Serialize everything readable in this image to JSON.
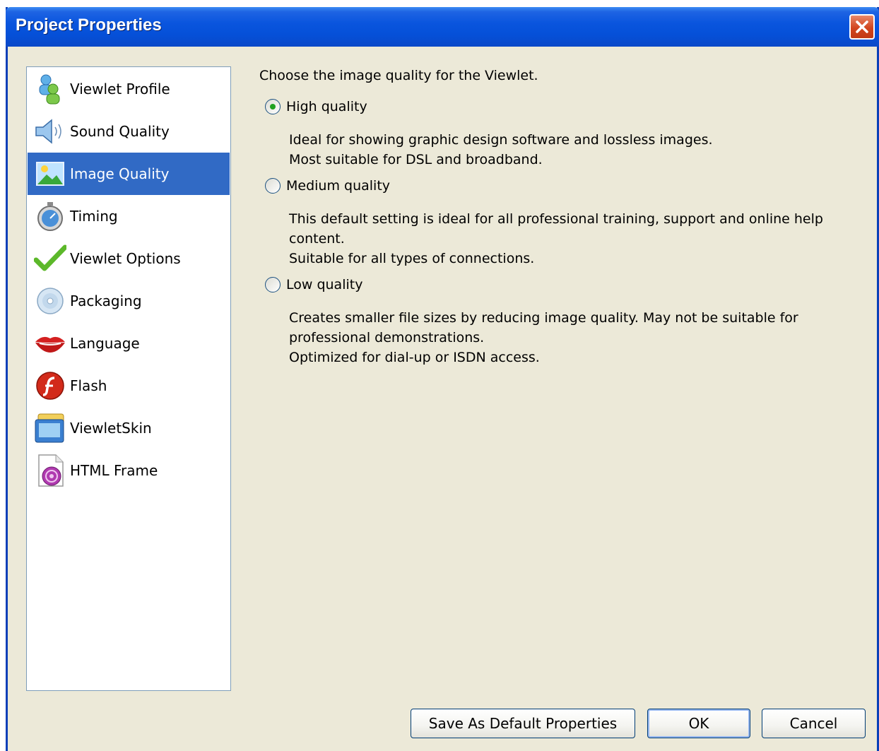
{
  "window": {
    "title": "Project Properties"
  },
  "sidebar": {
    "items": [
      {
        "label": "Viewlet Profile",
        "icon": "profile-icon",
        "selected": false
      },
      {
        "label": "Sound Quality",
        "icon": "speaker-icon",
        "selected": false
      },
      {
        "label": "Image Quality",
        "icon": "image-icon",
        "selected": true
      },
      {
        "label": "Timing",
        "icon": "stopwatch-icon",
        "selected": false
      },
      {
        "label": "Viewlet Options",
        "icon": "checkmark-icon",
        "selected": false
      },
      {
        "label": "Packaging",
        "icon": "disc-icon",
        "selected": false
      },
      {
        "label": "Language",
        "icon": "lips-icon",
        "selected": false
      },
      {
        "label": "Flash",
        "icon": "flash-icon",
        "selected": false
      },
      {
        "label": "ViewletSkin",
        "icon": "skin-window-icon",
        "selected": false
      },
      {
        "label": "HTML Frame",
        "icon": "html-frame-icon",
        "selected": false
      }
    ]
  },
  "main": {
    "prompt": "Choose the image quality for the Viewlet.",
    "options": [
      {
        "label": "High quality",
        "checked": true,
        "lines": [
          "Ideal for showing graphic design software and lossless images.",
          "Most suitable for DSL and broadband."
        ]
      },
      {
        "label": "Medium quality",
        "checked": false,
        "lines": [
          "This default setting is ideal for all professional training, support and online help",
          "content.",
          "Suitable for all types of connections."
        ]
      },
      {
        "label": "Low quality",
        "checked": false,
        "lines": [
          "Creates smaller file sizes by reducing image quality. May not be suitable for",
          "professional demonstrations.",
          "Optimized for dial-up or ISDN access."
        ]
      }
    ]
  },
  "buttons": {
    "save_default": "Save As Default Properties",
    "ok": "OK",
    "cancel": "Cancel"
  },
  "colors": {
    "selection": "#316ac5",
    "titlebar": "#0a55de",
    "dialog_bg": "#ece9d8"
  }
}
